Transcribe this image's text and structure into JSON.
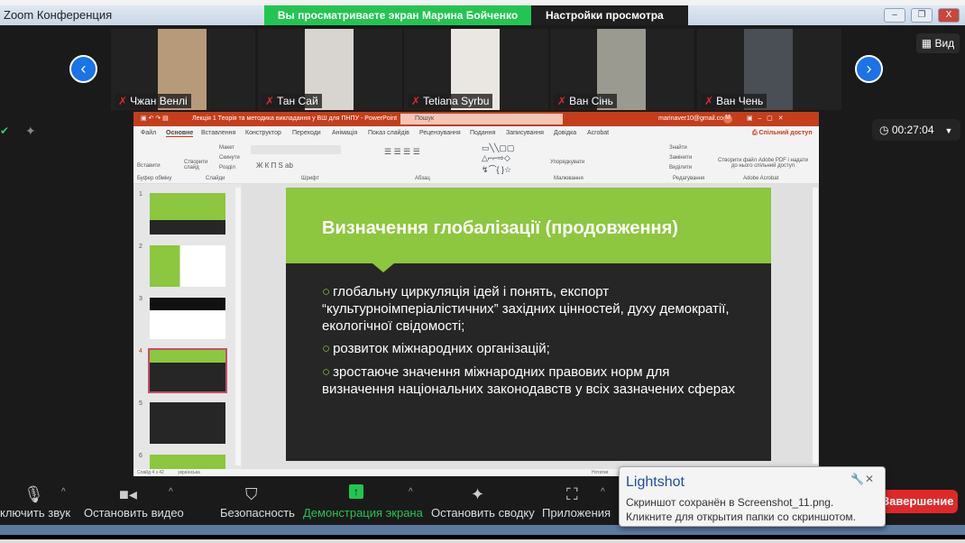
{
  "window": {
    "title": "Zoom Конференция",
    "minimize": "–",
    "restore": "❐",
    "close": "X"
  },
  "share_banner": "Вы просматриваете экран Марина Бойченко",
  "view_settings": "Настройки просмотра",
  "view_settings_caret": "⌄",
  "participants": [
    {
      "name": "Чжан Венлі"
    },
    {
      "name": "Тан Сай"
    },
    {
      "name": "Tetiana Syrbu"
    },
    {
      "name": "Ван Сінь"
    },
    {
      "name": "Ван Чень"
    }
  ],
  "view_button": "Вид",
  "timer": "00:27:04",
  "powerpoint": {
    "doc_title": "Лекція 1 Теорія та методика викладання у ВШ для ПНПУ - PowerPoint",
    "search": "Пошук",
    "email": "marinaver10@gmail.com",
    "avatar": "M",
    "tabs": [
      "Файл",
      "Основне",
      "Вставлення",
      "Конструктор",
      "Переходи",
      "Анімація",
      "Показ слайдів",
      "Рецензування",
      "Подання",
      "Записування",
      "Довідка",
      "Acrobat"
    ],
    "share": "Спільний доступ",
    "groups": [
      "Буфер обміну",
      "Слайди",
      "Шрифт",
      "Абзац",
      "Малювання",
      "Редагування",
      "Adobe Acrobat"
    ],
    "ribbon_items": {
      "paste": "Вставити",
      "new_slide": "Створити слайд",
      "layout": "Макет",
      "reset": "Скинути",
      "section": "Розділ",
      "arrange": "Упорядкувати",
      "find": "Знайти",
      "replace": "Замінити",
      "select": "Виділити",
      "adobe": "Створити файл Adobe PDF і надати до нього спільний доступ"
    },
    "thumbnails": [
      "1",
      "2",
      "3",
      "4",
      "5",
      "6"
    ],
    "selected_slide": 4,
    "slide": {
      "title": "Визначення глобалізації (продовження)",
      "bullets": [
        "глобальну циркуляція ідей і понять, експорт “культурноімперіалістичних” західних цінностей, духу демократії, екологічної свідомості;",
        "розвиток міжнародних організацій;",
        "зростаюче значення міжнародних правових норм для визначення національних законодавств у всіх зазначених сферах"
      ]
    },
    "status": "Слайд 4 з 42",
    "language": "українська",
    "notes": "Нотатки"
  },
  "toolbar": {
    "mute": "ключить звук",
    "video": "Остановить видео",
    "security": "Безопасность",
    "share": "Демонстрация экрана",
    "summary": "Остановить сводку",
    "apps": "Приложения",
    "end": "Завершение"
  },
  "toast": {
    "title": "Lightshot",
    "message": "Скриншот сохранён в Screenshot_11.png. Кликните для открытия папки со скриншотом."
  },
  "colors": {
    "share_green": "#23c552",
    "ppt_orange": "#c43e1c",
    "slide_green": "#8dc63f",
    "end_red": "#e02828",
    "nav_blue": "#1a73e8"
  }
}
